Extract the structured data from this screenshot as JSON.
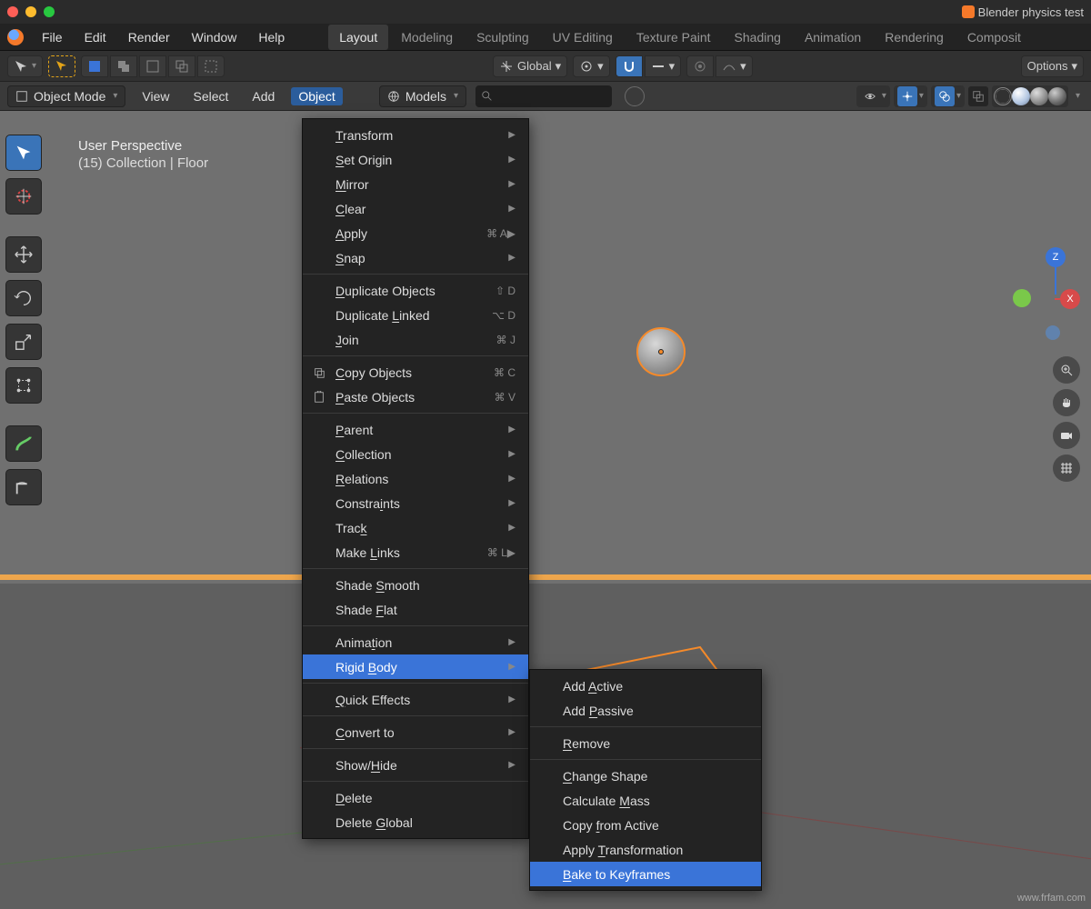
{
  "window": {
    "title": "Blender physics test"
  },
  "menubar": {
    "items": [
      "File",
      "Edit",
      "Render",
      "Window",
      "Help"
    ]
  },
  "workspaces": {
    "items": [
      "Layout",
      "Modeling",
      "Sculpting",
      "UV Editing",
      "Texture Paint",
      "Shading",
      "Animation",
      "Rendering",
      "Composit"
    ],
    "active": "Layout"
  },
  "header1": {
    "orientation_label": "Global",
    "options_label": "Options"
  },
  "header2": {
    "mode": "Object Mode",
    "items": [
      "View",
      "Select",
      "Add",
      "Object"
    ],
    "active": "Object",
    "models_label": "Models"
  },
  "viewport": {
    "line1": "User Perspective",
    "line2": "(15) Collection | Floor"
  },
  "object_menu": [
    {
      "label": "Transform",
      "sub": true,
      "u": 0
    },
    {
      "label": "Set Origin",
      "sub": true,
      "u": 0
    },
    {
      "label": "Mirror",
      "sub": true,
      "u": 0
    },
    {
      "label": "Clear",
      "sub": true,
      "u": 0
    },
    {
      "label": "Apply",
      "sub": true,
      "sc": "⌘ A▶",
      "u": 0
    },
    {
      "label": "Snap",
      "sub": true,
      "u": 0
    },
    {
      "sep": true
    },
    {
      "label": "Duplicate Objects",
      "sc": "⇧ D",
      "u": 0
    },
    {
      "label": "Duplicate Linked",
      "sc": "⌥ D",
      "u": 10
    },
    {
      "label": "Join",
      "sc": "⌘ J",
      "u": 0
    },
    {
      "sep": true
    },
    {
      "label": "Copy Objects",
      "sc": "⌘ C",
      "icon": "copy",
      "u": 0
    },
    {
      "label": "Paste Objects",
      "sc": "⌘ V",
      "icon": "paste",
      "u": 0
    },
    {
      "sep": true
    },
    {
      "label": "Parent",
      "sub": true,
      "u": 0
    },
    {
      "label": "Collection",
      "sub": true,
      "u": 0
    },
    {
      "label": "Relations",
      "sub": true,
      "u": 0
    },
    {
      "label": "Constraints",
      "sub": true,
      "u": 7
    },
    {
      "label": "Track",
      "sub": true,
      "u": 4
    },
    {
      "label": "Make Links",
      "sc": "⌘ L▶",
      "u": 5
    },
    {
      "sep": true
    },
    {
      "label": "Shade Smooth",
      "u": 6
    },
    {
      "label": "Shade Flat",
      "u": 6
    },
    {
      "sep": true
    },
    {
      "label": "Animation",
      "sub": true,
      "u": 5
    },
    {
      "label": "Rigid Body",
      "sub": true,
      "hl": true,
      "u": 6
    },
    {
      "sep": true
    },
    {
      "label": "Quick Effects",
      "sub": true,
      "u": 0
    },
    {
      "sep": true
    },
    {
      "label": "Convert to",
      "sub": true,
      "u": 0
    },
    {
      "sep": true
    },
    {
      "label": "Show/Hide",
      "sub": true,
      "u": 5
    },
    {
      "sep": true
    },
    {
      "label": "Delete",
      "u": 0
    },
    {
      "label": "Delete Global",
      "u": 7
    }
  ],
  "rigid_body_submenu": [
    {
      "label": "Add Active",
      "u": 4
    },
    {
      "label": "Add Passive",
      "u": 4
    },
    {
      "sep": true
    },
    {
      "label": "Remove",
      "u": 0
    },
    {
      "sep": true
    },
    {
      "label": "Change Shape",
      "u": 0
    },
    {
      "label": "Calculate Mass",
      "u": 10
    },
    {
      "label": "Copy from Active",
      "u": 5
    },
    {
      "label": "Apply Transformation",
      "u": 6
    },
    {
      "label": "Bake to Keyframes",
      "hl": true,
      "u": 0
    }
  ],
  "watermark": "www.frfam.com"
}
